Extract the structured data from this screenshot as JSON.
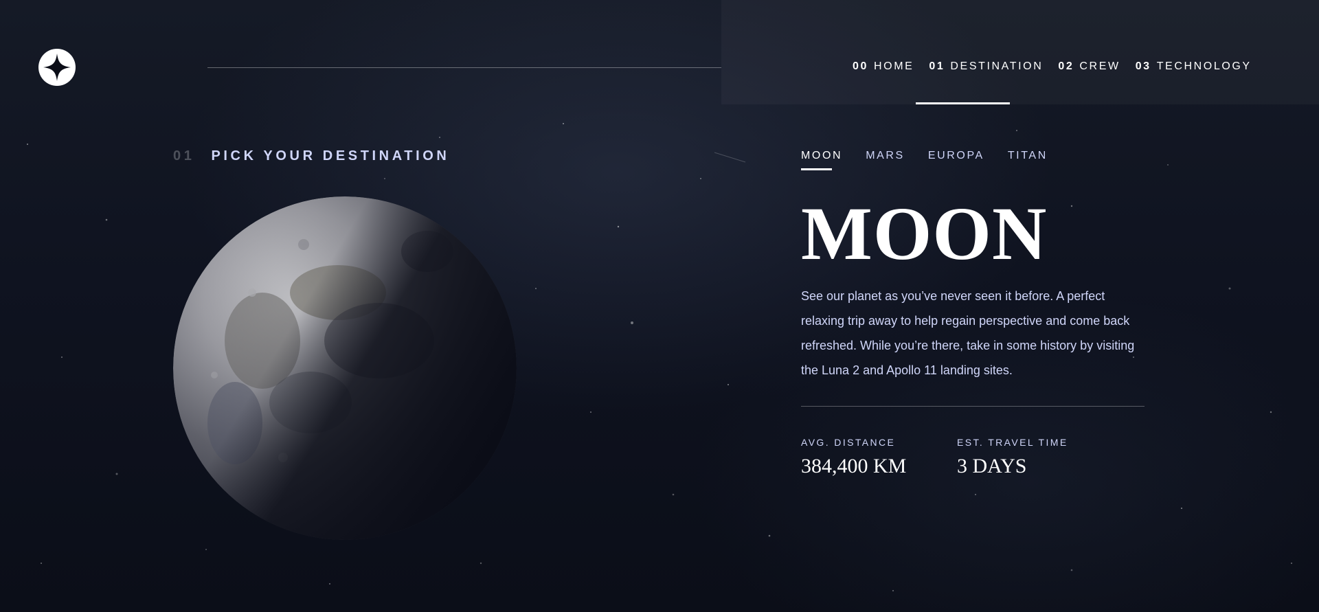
{
  "header": {
    "logo_icon": "star-logo-icon",
    "nav": [
      {
        "num": "00",
        "label": "HOME"
      },
      {
        "num": "01",
        "label": "DESTINATION"
      },
      {
        "num": "02",
        "label": "CREW"
      },
      {
        "num": "03",
        "label": "TECHNOLOGY"
      }
    ],
    "active_nav": "DESTINATION"
  },
  "heading": {
    "num": "01",
    "text": "PICK YOUR DESTINATION"
  },
  "destination_tabs": [
    "MOON",
    "MARS",
    "EUROPA",
    "TITAN"
  ],
  "active_tab": "MOON",
  "destination": {
    "name": "MOON",
    "description": "See our planet as you’ve never seen it before. A perfect relaxing trip away to help regain perspective and come back refreshed. While you’re there, take in some history by visiting the Luna 2 and Apollo 11 landing sites.",
    "stats": [
      {
        "label": "AVG. DISTANCE",
        "value": "384,400 KM"
      },
      {
        "label": "EST. TRAVEL TIME",
        "value": "3 DAYS"
      }
    ]
  },
  "colors": {
    "background": "#0b0d17",
    "accent_text": "#d0d6f9",
    "white": "#ffffff"
  }
}
